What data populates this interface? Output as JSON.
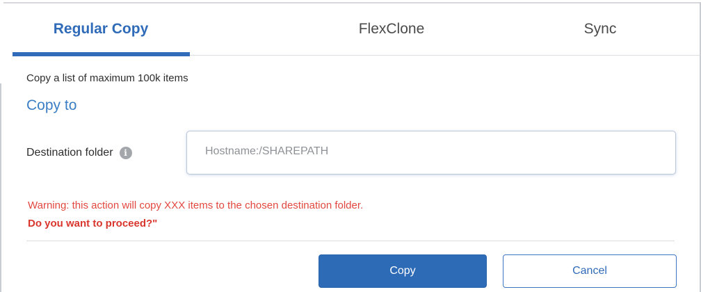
{
  "tabs": [
    {
      "label": "Regular Copy",
      "active": true
    },
    {
      "label": "FlexClone",
      "active": false
    },
    {
      "label": "Sync",
      "active": false
    }
  ],
  "subtitle": "Copy a list of maximum 100k items",
  "section_title": "Copy to",
  "destination": {
    "label": "Destination folder",
    "info_icon": "info-icon",
    "value": "",
    "placeholder": "Hostname:/SHAREPATH"
  },
  "warning_text": "Warning: this action will copy XXX items to the chosen destination folder.",
  "proceed_text": "Do you want to proceed?\"",
  "buttons": {
    "copy_label": "Copy",
    "cancel_label": "Cancel"
  },
  "colors": {
    "accent": "#2f6bb8",
    "warning": "#e2473f",
    "primary_button": "#2e6bb7"
  }
}
